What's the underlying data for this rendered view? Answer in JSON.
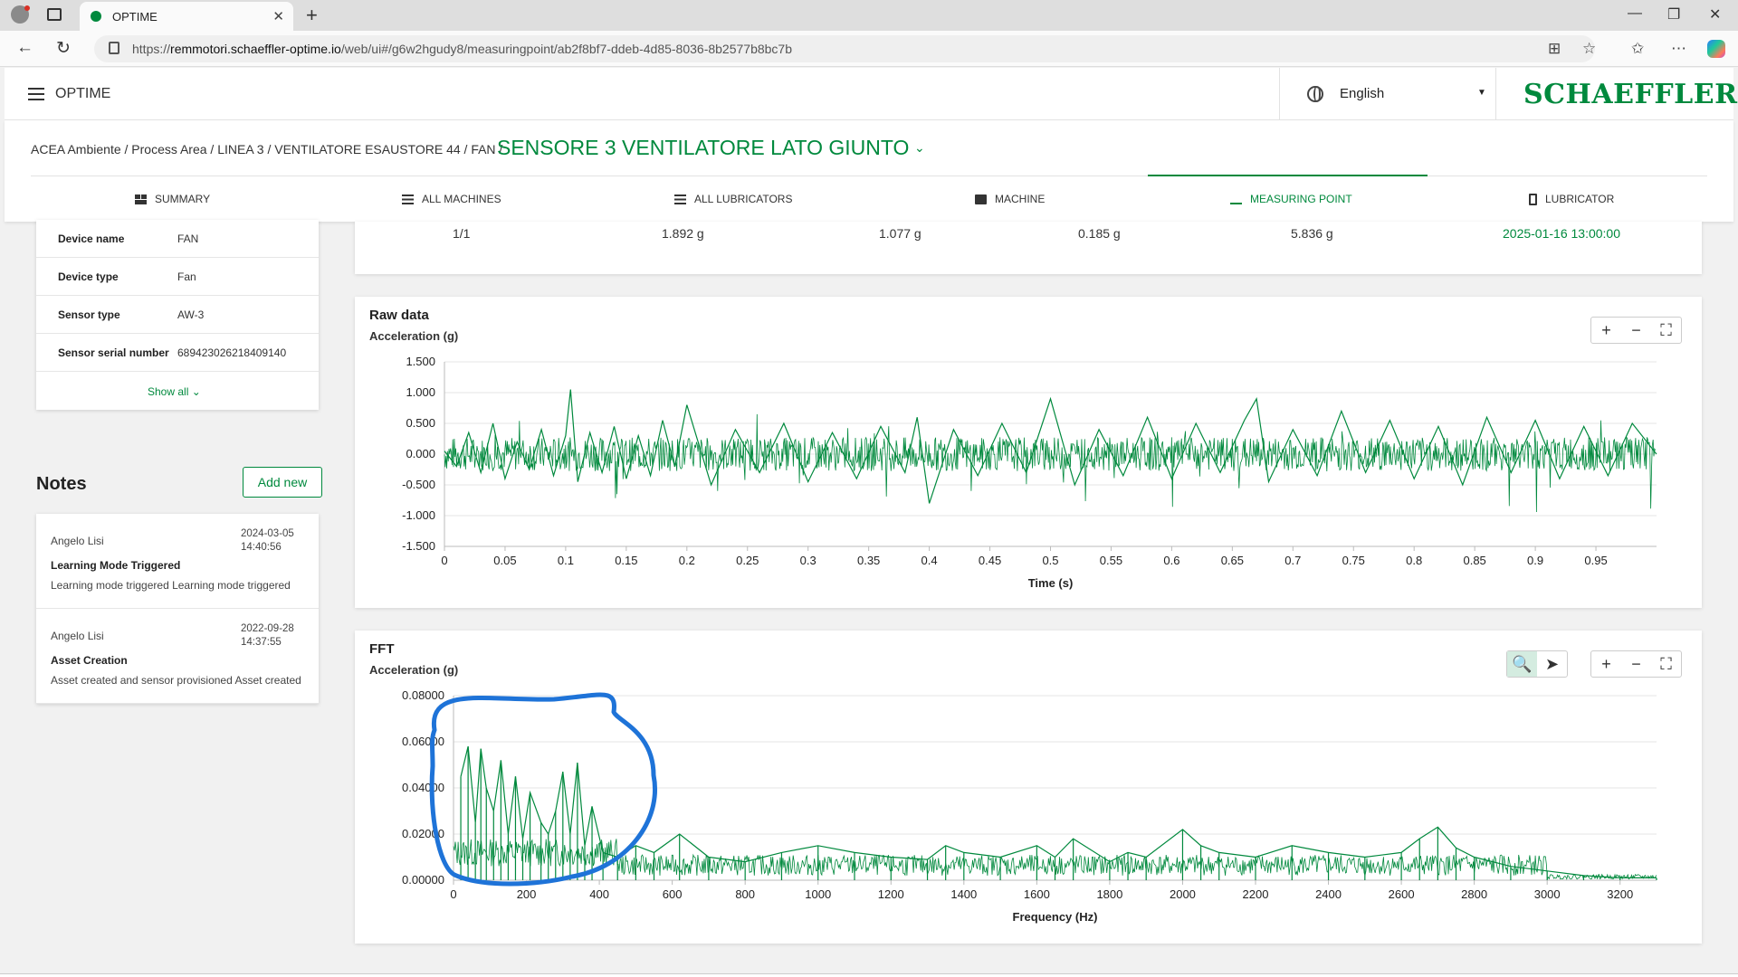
{
  "browser": {
    "tab_title": "OPTIME",
    "url_prefix": "https://",
    "url_host": "remmotori.schaeffler-optime.io",
    "url_path": "/web/ui#/g6w2hgudy8/measuringpoint/ab2f8bf7-ddeb-4d85-8036-8b2577b8bc7b"
  },
  "header": {
    "app_title": "OPTIME",
    "language": "English",
    "brand": "SCHAEFFLER"
  },
  "breadcrumb": {
    "path": "ACEA Ambiente / Process Area / LINEA 3 / VENTILATORE ESAUSTORE 44 / FAN /",
    "current": "SENSORE 3 VENTILATORE LATO GIUNTO"
  },
  "nav_tabs": [
    {
      "label": "SUMMARY",
      "icon": "grid-icon"
    },
    {
      "label": "ALL MACHINES",
      "icon": "list-icon"
    },
    {
      "label": "ALL LUBRICATORS",
      "icon": "list-icon"
    },
    {
      "label": "MACHINE",
      "icon": "machine-icon"
    },
    {
      "label": "MEASURING POINT",
      "icon": "waveform-icon"
    },
    {
      "label": "LUBRICATOR",
      "icon": "lubricator-icon"
    }
  ],
  "device_info": [
    {
      "key": "Device name",
      "value": "FAN"
    },
    {
      "key": "Device type",
      "value": "Fan"
    },
    {
      "key": "Sensor type",
      "value": "AW-3"
    },
    {
      "key": "Sensor serial number",
      "value": "689423026218409140"
    }
  ],
  "show_all": "Show all",
  "notes": {
    "title": "Notes",
    "add_label": "Add new",
    "items": [
      {
        "author": "Angelo Lisi",
        "date": "2024-03-05",
        "time": "14:40:56",
        "title": "Learning Mode Triggered",
        "text": "Learning mode triggered Learning mode triggered"
      },
      {
        "author": "Angelo Lisi",
        "date": "2022-09-28",
        "time": "14:37:55",
        "title": "Asset Creation",
        "text": "Asset created and sensor provisioned Asset created"
      }
    ]
  },
  "summary_row": [
    "1/1",
    "1.892 g",
    "1.077 g",
    "0.185 g",
    "5.836 g",
    "2025-01-16 13:00:00"
  ],
  "raw_chart": {
    "title": "Raw data",
    "ylabel": "Acceleration (g)",
    "xlabel": "Time (s)"
  },
  "fft_chart": {
    "title": "FFT",
    "ylabel": "Acceleration (g)",
    "xlabel": "Frequency (Hz)"
  },
  "chart_data": [
    {
      "type": "line",
      "title": "Raw data",
      "xlabel": "Time (s)",
      "ylabel": "Acceleration (g)",
      "xlim": [
        0,
        1.0
      ],
      "ylim": [
        -1.5,
        1.5
      ],
      "x_ticks": [
        "0",
        "0.05",
        "0.1",
        "0.15",
        "0.2",
        "0.25",
        "0.3",
        "0.35",
        "0.4",
        "0.45",
        "0.5",
        "0.55",
        "0.6",
        "0.65",
        "0.7",
        "0.75",
        "0.8",
        "0.85",
        "0.9",
        "0.95"
      ],
      "y_ticks": [
        "1.500",
        "1.000",
        "0.500",
        "0.000",
        "-0.500",
        "-1.000",
        "-1.500"
      ],
      "color": "#00893d",
      "series": [
        {
          "x": [
            0.0,
            0.01,
            0.02,
            0.03,
            0.04,
            0.05,
            0.06,
            0.07,
            0.08,
            0.09,
            0.1,
            0.104,
            0.11,
            0.12,
            0.13,
            0.14,
            0.15,
            0.16,
            0.17,
            0.18,
            0.19,
            0.2,
            0.22,
            0.24,
            0.26,
            0.28,
            0.3,
            0.32,
            0.34,
            0.36,
            0.38,
            0.39,
            0.4,
            0.42,
            0.44,
            0.46,
            0.48,
            0.5,
            0.52,
            0.54,
            0.56,
            0.58,
            0.6,
            0.62,
            0.64,
            0.66,
            0.67,
            0.68,
            0.7,
            0.72,
            0.74,
            0.76,
            0.78,
            0.8,
            0.82,
            0.84,
            0.86,
            0.88,
            0.9,
            0.92,
            0.94,
            0.96,
            0.98,
            1.0
          ],
          "y": [
            0.05,
            -0.2,
            0.35,
            -0.3,
            0.5,
            -0.4,
            0.2,
            -0.25,
            0.4,
            -0.35,
            0.3,
            1.05,
            -0.45,
            0.35,
            -0.3,
            0.45,
            -0.4,
            0.3,
            -0.35,
            0.55,
            -0.2,
            0.8,
            -0.5,
            0.4,
            -0.3,
            0.5,
            -0.45,
            0.35,
            -0.4,
            0.45,
            -0.3,
            0.6,
            -0.8,
            0.4,
            -0.35,
            0.5,
            -0.3,
            0.9,
            -0.5,
            0.4,
            -0.35,
            0.6,
            -0.4,
            0.5,
            -0.3,
            0.55,
            0.9,
            -0.45,
            0.4,
            -0.35,
            0.7,
            -0.3,
            0.55,
            -0.4,
            0.45,
            -0.5,
            0.6,
            -0.3,
            0.55,
            -0.4,
            0.45,
            -0.35,
            0.5,
            0.0
          ]
        }
      ]
    },
    {
      "type": "line",
      "title": "FFT",
      "xlabel": "Frequency (Hz)",
      "ylabel": "Acceleration (g)",
      "xlim": [
        0,
        3300
      ],
      "ylim": [
        0,
        0.08
      ],
      "x_ticks": [
        "0",
        "200",
        "400",
        "600",
        "800",
        "1000",
        "1200",
        "1400",
        "1600",
        "1800",
        "2000",
        "2200",
        "2400",
        "2600",
        "2800",
        "3000",
        "3200"
      ],
      "y_ticks": [
        "0.08000",
        "0.06000",
        "0.04000",
        "0.02000",
        "0.00000"
      ],
      "color": "#00893d",
      "series": [
        {
          "x": [
            20,
            40,
            60,
            75,
            90,
            110,
            130,
            150,
            170,
            190,
            210,
            240,
            260,
            280,
            300,
            320,
            340,
            360,
            380,
            410,
            450,
            500,
            550,
            620,
            700,
            800,
            900,
            1000,
            1100,
            1200,
            1300,
            1350,
            1400,
            1500,
            1600,
            1650,
            1700,
            1800,
            1850,
            1900,
            2000,
            2050,
            2100,
            2200,
            2300,
            2400,
            2500,
            2600,
            2650,
            2700,
            2750,
            2800,
            2900,
            3000,
            3100,
            3200,
            3300
          ],
          "y": [
            0.045,
            0.058,
            0.025,
            0.057,
            0.04,
            0.03,
            0.052,
            0.02,
            0.045,
            0.018,
            0.038,
            0.025,
            0.02,
            0.03,
            0.047,
            0.02,
            0.051,
            0.015,
            0.032,
            0.012,
            0.01,
            0.015,
            0.012,
            0.02,
            0.01,
            0.008,
            0.012,
            0.015,
            0.012,
            0.01,
            0.009,
            0.015,
            0.012,
            0.01,
            0.015,
            0.01,
            0.018,
            0.008,
            0.012,
            0.01,
            0.022,
            0.015,
            0.012,
            0.01,
            0.015,
            0.012,
            0.01,
            0.012,
            0.018,
            0.023,
            0.014,
            0.01,
            0.006,
            0.004,
            0.002,
            0.001,
            0.001
          ]
        }
      ]
    }
  ]
}
